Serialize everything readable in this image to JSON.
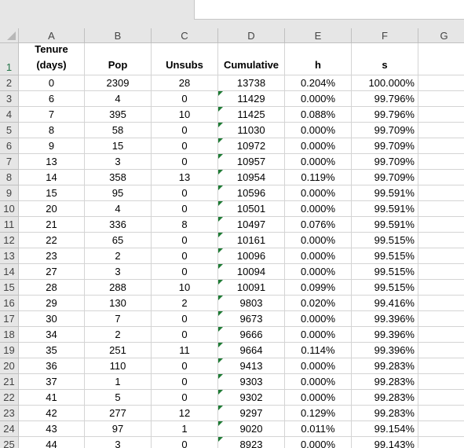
{
  "column_headers": [
    "A",
    "B",
    "C",
    "D",
    "E",
    "F",
    "G"
  ],
  "header_row": {
    "row_number": "1",
    "a_line1": "Tenure",
    "a_line2": "(days)",
    "b": "Pop",
    "c": "Unsubs",
    "d": "Cumulative",
    "e": "h",
    "f": "s"
  },
  "rows": [
    {
      "n": "2",
      "tenure": "0",
      "pop": "2309",
      "unsubs": "28",
      "cumulative": "13738",
      "h": "0.204%",
      "s": "100.000%"
    },
    {
      "n": "3",
      "tenure": "6",
      "pop": "4",
      "unsubs": "0",
      "cumulative": "11429",
      "h": "0.000%",
      "s": "99.796%"
    },
    {
      "n": "4",
      "tenure": "7",
      "pop": "395",
      "unsubs": "10",
      "cumulative": "11425",
      "h": "0.088%",
      "s": "99.796%"
    },
    {
      "n": "5",
      "tenure": "8",
      "pop": "58",
      "unsubs": "0",
      "cumulative": "11030",
      "h": "0.000%",
      "s": "99.709%"
    },
    {
      "n": "6",
      "tenure": "9",
      "pop": "15",
      "unsubs": "0",
      "cumulative": "10972",
      "h": "0.000%",
      "s": "99.709%"
    },
    {
      "n": "7",
      "tenure": "13",
      "pop": "3",
      "unsubs": "0",
      "cumulative": "10957",
      "h": "0.000%",
      "s": "99.709%"
    },
    {
      "n": "8",
      "tenure": "14",
      "pop": "358",
      "unsubs": "13",
      "cumulative": "10954",
      "h": "0.119%",
      "s": "99.709%"
    },
    {
      "n": "9",
      "tenure": "15",
      "pop": "95",
      "unsubs": "0",
      "cumulative": "10596",
      "h": "0.000%",
      "s": "99.591%"
    },
    {
      "n": "10",
      "tenure": "20",
      "pop": "4",
      "unsubs": "0",
      "cumulative": "10501",
      "h": "0.000%",
      "s": "99.591%"
    },
    {
      "n": "11",
      "tenure": "21",
      "pop": "336",
      "unsubs": "8",
      "cumulative": "10497",
      "h": "0.076%",
      "s": "99.591%"
    },
    {
      "n": "12",
      "tenure": "22",
      "pop": "65",
      "unsubs": "0",
      "cumulative": "10161",
      "h": "0.000%",
      "s": "99.515%"
    },
    {
      "n": "13",
      "tenure": "23",
      "pop": "2",
      "unsubs": "0",
      "cumulative": "10096",
      "h": "0.000%",
      "s": "99.515%"
    },
    {
      "n": "14",
      "tenure": "27",
      "pop": "3",
      "unsubs": "0",
      "cumulative": "10094",
      "h": "0.000%",
      "s": "99.515%"
    },
    {
      "n": "15",
      "tenure": "28",
      "pop": "288",
      "unsubs": "10",
      "cumulative": "10091",
      "h": "0.099%",
      "s": "99.515%"
    },
    {
      "n": "16",
      "tenure": "29",
      "pop": "130",
      "unsubs": "2",
      "cumulative": "9803",
      "h": "0.020%",
      "s": "99.416%"
    },
    {
      "n": "17",
      "tenure": "30",
      "pop": "7",
      "unsubs": "0",
      "cumulative": "9673",
      "h": "0.000%",
      "s": "99.396%"
    },
    {
      "n": "18",
      "tenure": "34",
      "pop": "2",
      "unsubs": "0",
      "cumulative": "9666",
      "h": "0.000%",
      "s": "99.396%"
    },
    {
      "n": "19",
      "tenure": "35",
      "pop": "251",
      "unsubs": "11",
      "cumulative": "9664",
      "h": "0.114%",
      "s": "99.396%"
    },
    {
      "n": "20",
      "tenure": "36",
      "pop": "110",
      "unsubs": "0",
      "cumulative": "9413",
      "h": "0.000%",
      "s": "99.283%"
    },
    {
      "n": "21",
      "tenure": "37",
      "pop": "1",
      "unsubs": "0",
      "cumulative": "9303",
      "h": "0.000%",
      "s": "99.283%"
    },
    {
      "n": "22",
      "tenure": "41",
      "pop": "5",
      "unsubs": "0",
      "cumulative": "9302",
      "h": "0.000%",
      "s": "99.283%"
    },
    {
      "n": "23",
      "tenure": "42",
      "pop": "277",
      "unsubs": "12",
      "cumulative": "9297",
      "h": "0.129%",
      "s": "99.283%"
    },
    {
      "n": "24",
      "tenure": "43",
      "pop": "97",
      "unsubs": "1",
      "cumulative": "9020",
      "h": "0.011%",
      "s": "99.154%"
    },
    {
      "n": "25",
      "tenure": "44",
      "pop": "3",
      "unsubs": "0",
      "cumulative": "8923",
      "h": "0.000%",
      "s": "99.143%"
    }
  ],
  "colors": {
    "header_bg": "#e6e6e6",
    "gridline": "#d4d4d4",
    "error_flag": "#1e7b34",
    "selected_row_number": "#217346"
  }
}
